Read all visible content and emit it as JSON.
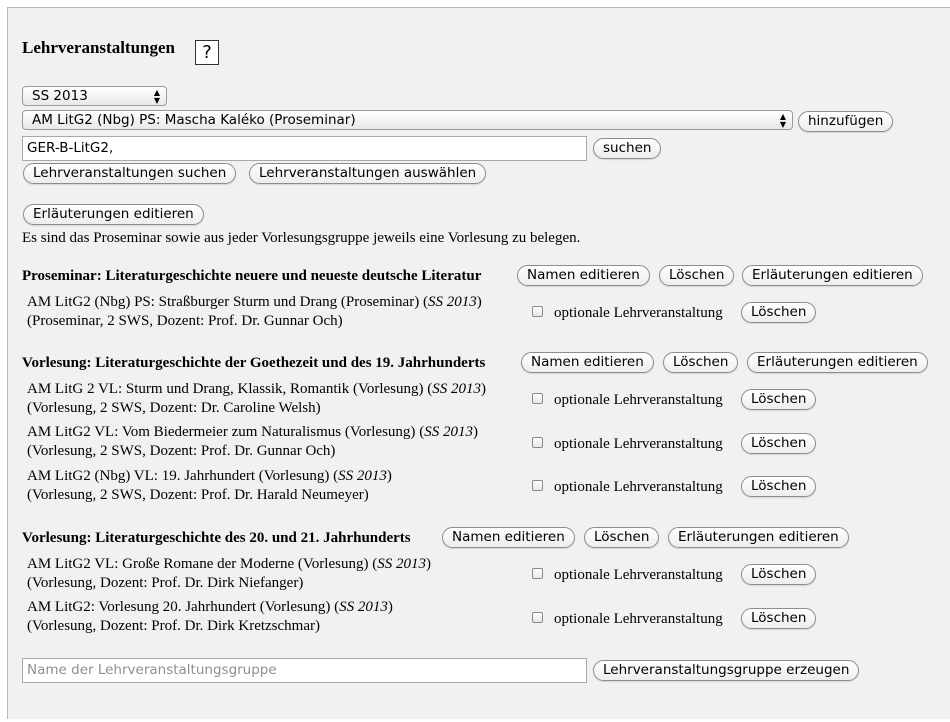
{
  "title": "Lehrveranstaltungen",
  "help_label": "?",
  "semester_select": "SS 2013",
  "course_select": "AM LitG2 (Nbg) PS: Mascha Kaléko (Proseminar)",
  "add_button": "hinzufügen",
  "search_input_value": "GER-B-LitG2,",
  "search_button": "suchen",
  "search_courses_button": "Lehrveranstaltungen suchen",
  "select_courses_button": "Lehrveranstaltungen auswählen",
  "edit_explanations_button": "Erläuterungen editieren",
  "explanation_text": "Es sind das Proseminar sowie aus jeder Vorlesungsgruppe jeweils eine Vorlesung zu belegen.",
  "group_buttons": {
    "edit_names": "Namen editieren",
    "delete": "Löschen",
    "edit_explanations": "Erläuterungen editieren"
  },
  "optional_label": "optionale Lehrveranstaltung",
  "delete_label": "Löschen",
  "groups": [
    {
      "title": "Proseminar: Literaturgeschichte neuere und neueste deutsche Literatur",
      "courses": [
        {
          "name": "AM LitG2 (Nbg) PS: Straßburger Sturm und Drang (Proseminar)",
          "semester": "SS 2013",
          "details": "(Proseminar, 2 SWS, Dozent: Prof. Dr. Gunnar Och)"
        }
      ]
    },
    {
      "title": "Vorlesung: Literaturgeschichte der Goethezeit und des 19. Jahrhunderts",
      "courses": [
        {
          "name": "AM LitG 2 VL: Sturm und Drang, Klassik, Romantik (Vorlesung)",
          "semester": "SS 2013",
          "details": "(Vorlesung, 2 SWS, Dozent: Dr. Caroline Welsh)"
        },
        {
          "name": "AM LitG2 VL: Vom Biedermeier zum Naturalismus (Vorlesung)",
          "semester": "SS 2013",
          "details": "(Vorlesung, 2 SWS, Dozent: Prof. Dr. Gunnar Och)"
        },
        {
          "name": "AM LitG2 (Nbg) VL: 19. Jahrhundert (Vorlesung)",
          "semester": "SS 2013",
          "details": "(Vorlesung, 2 SWS, Dozent: Prof. Dr. Harald Neumeyer)"
        }
      ]
    },
    {
      "title": "Vorlesung: Literaturgeschichte des 20. und 21. Jahrhunderts",
      "courses": [
        {
          "name": "AM LitG2 VL: Große Romane der Moderne (Vorlesung)",
          "semester": "SS 2013",
          "details": "(Vorlesung, Dozent: Prof. Dr. Dirk Niefanger)"
        },
        {
          "name": "AM LitG2: Vorlesung 20. Jahrhundert (Vorlesung)",
          "semester": "SS 2013",
          "details": "(Vorlesung, Dozent: Prof. Dr. Dirk Kretzschmar)"
        }
      ]
    }
  ],
  "group_name_placeholder": "Name der Lehrveranstaltungsgruppe",
  "create_group_button": "Lehrveranstaltungsgruppe erzeugen"
}
